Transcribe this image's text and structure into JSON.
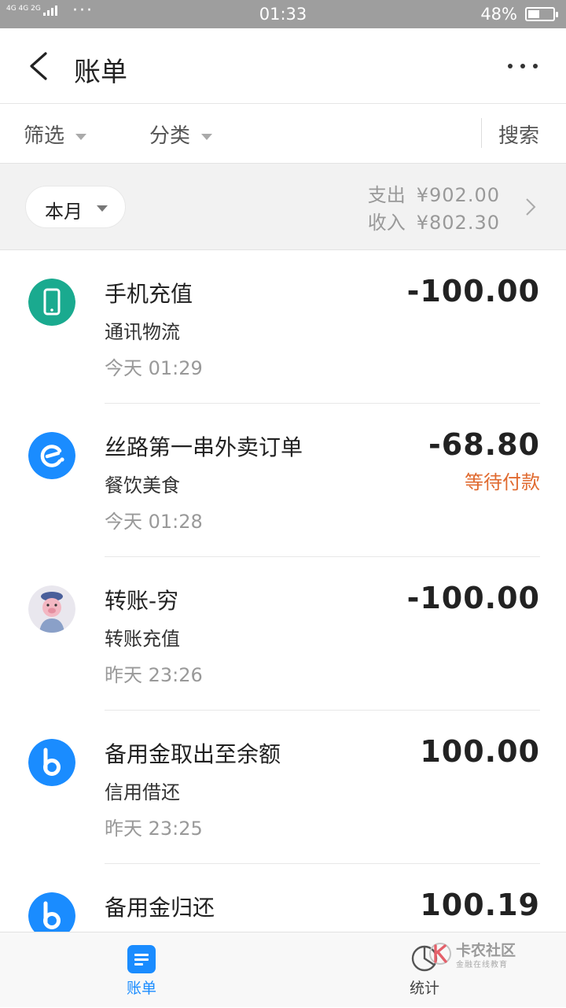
{
  "status_bar": {
    "network": "4G 4G 2G",
    "time": "01:33",
    "battery": "48%",
    "battery_level": 0.48
  },
  "header": {
    "title": "账单"
  },
  "filters": {
    "filter_label": "筛选",
    "category_label": "分类",
    "search_label": "搜索"
  },
  "summary": {
    "period": "本月",
    "expense_label": "支出",
    "expense_value": "¥902.00",
    "income_label": "收入",
    "income_value": "¥802.30"
  },
  "transactions": [
    {
      "name": "手机充值",
      "category": "通讯物流",
      "time": "今天  01:29",
      "amount": "-100.00",
      "status": "",
      "icon": "phone-icon"
    },
    {
      "name": "丝路第一串外卖订单",
      "category": "餐饮美食",
      "time": "今天  01:28",
      "amount": "-68.80",
      "status": "等待付款",
      "icon": "eleme-icon"
    },
    {
      "name": "转账-穷",
      "category": "转账充值",
      "time": "昨天  23:26",
      "amount": "-100.00",
      "status": "",
      "icon": "user-avatar"
    },
    {
      "name": "备用金取出至余额",
      "category": "信用借还",
      "time": "昨天  23:25",
      "amount": "100.00",
      "status": "",
      "icon": "credit-b-icon"
    },
    {
      "name": "备用金归还",
      "category": "",
      "time": "",
      "amount": "100.19",
      "status": "",
      "icon": "credit-b-icon"
    }
  ],
  "tabbar": {
    "bill_label": "账单",
    "stats_label": "统计"
  },
  "watermark": {
    "title": "卡农社区",
    "subtitle": "金融在线教育"
  },
  "colors": {
    "accent": "#1a8cff",
    "pending": "#e06a2f",
    "teal": "#1aaa8f",
    "status_bar": "#9e9e9e"
  }
}
